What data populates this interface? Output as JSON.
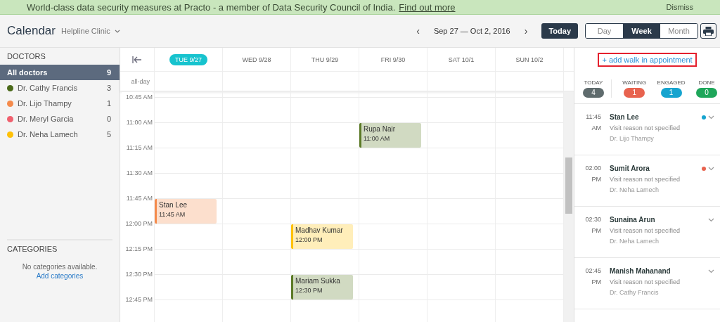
{
  "banner": {
    "message": "World-class data security measures at Practo - a member of Data Security Council of India.",
    "link": "Find out more",
    "dismiss": "Dismiss"
  },
  "header": {
    "title": "Calendar",
    "clinic": "Helpline Clinic",
    "range": "Sep 27 — Oct 2, 2016",
    "prev": "‹",
    "next": "›",
    "today": "Today",
    "views": [
      {
        "label": "Day",
        "selected": false
      },
      {
        "label": "Week",
        "selected": true
      },
      {
        "label": "Month",
        "selected": false
      }
    ]
  },
  "sidebar": {
    "doctors_heading": "DOCTORS",
    "doctors": [
      {
        "name": "All doctors",
        "count": "9",
        "selected": true
      },
      {
        "name": "Dr. Cathy Francis",
        "count": "3",
        "selected": false,
        "color": "#4b6a1a"
      },
      {
        "name": "Dr. Lijo Thampy",
        "count": "1",
        "selected": false,
        "color": "#f58b4c"
      },
      {
        "name": "Dr. Meryl Garcia",
        "count": "0",
        "selected": false,
        "color": "#f0606e"
      },
      {
        "name": "Dr. Neha Lamech",
        "count": "5",
        "selected": false,
        "color": "#ffc107"
      }
    ],
    "categories_heading": "CATEGORIES",
    "categories_empty": "No categories available.",
    "add_categories": "Add categories"
  },
  "calendar": {
    "days": [
      {
        "label": "TUE 9/27",
        "selected": true
      },
      {
        "label": "WED 9/28",
        "selected": false
      },
      {
        "label": "THU 9/29",
        "selected": false
      },
      {
        "label": "FRI 9/30",
        "selected": false
      },
      {
        "label": "SAT 10/1",
        "selected": false
      },
      {
        "label": "SUN 10/2",
        "selected": false
      }
    ],
    "all_day": "all-day",
    "rows": [
      {
        "time": "10:45 AM",
        "cells": [
          null,
          null,
          null,
          null,
          null,
          null
        ]
      },
      {
        "time": "11:00 AM",
        "cells": [
          null,
          null,
          null,
          {
            "name": "Rupa Nair",
            "time": "11:00 AM",
            "color": "#5b7a26"
          },
          null,
          null
        ]
      },
      {
        "time": "11:15 AM",
        "cells": [
          null,
          null,
          null,
          null,
          null,
          null
        ]
      },
      {
        "time": "11:30 AM",
        "cells": [
          null,
          null,
          null,
          null,
          null,
          null
        ]
      },
      {
        "time": "11:45 AM",
        "cells": [
          {
            "name": "Stan Lee",
            "time": "11:45 AM",
            "color": "#f58b4c"
          },
          null,
          null,
          null,
          null,
          null
        ]
      },
      {
        "time": "12:00 PM",
        "cells": [
          null,
          null,
          {
            "name": "Madhav Kumar",
            "time": "12:00 PM",
            "color": "#ffc107"
          },
          null,
          null,
          null
        ]
      },
      {
        "time": "12:15 PM",
        "cells": [
          null,
          null,
          null,
          null,
          null,
          null
        ]
      },
      {
        "time": "12:30 PM",
        "cells": [
          null,
          null,
          {
            "name": "Mariam Sukka",
            "time": "12:30 PM",
            "color": "#5b7a26"
          },
          null,
          null,
          null
        ]
      },
      {
        "time": "12:45 PM",
        "cells": [
          null,
          null,
          null,
          null,
          null,
          null
        ]
      }
    ]
  },
  "queue": {
    "add_walk_in": "+ add walk in appointment",
    "stats": [
      {
        "label": "TODAY",
        "count": "4",
        "color": "#5f6b6d"
      },
      {
        "label": "WAITING",
        "count": "1",
        "color": "#e8634f"
      },
      {
        "label": "ENGAGED",
        "count": "1",
        "color": "#16a4cf"
      },
      {
        "label": "DONE",
        "count": "0",
        "color": "#1ea65a"
      }
    ],
    "appointments": [
      {
        "hour": "11:45",
        "period": "AM",
        "patient": "Stan Lee",
        "reason": "Visit reason not specified",
        "doctor": "Dr. Lijo Thampy",
        "color": "#16a4cf"
      },
      {
        "hour": "02:00",
        "period": "PM",
        "patient": "Sumit Arora",
        "reason": "Visit reason not specified",
        "doctor": "Dr. Neha Lamech",
        "color": "#e8634f"
      },
      {
        "hour": "02:30",
        "period": "PM",
        "patient": "Sunaina Arun",
        "reason": "Visit reason not specified",
        "doctor": "Dr. Neha Lamech"
      },
      {
        "hour": "02:45",
        "period": "PM",
        "patient": "Manish Mahanand",
        "reason": "Visit reason not specified",
        "doctor": "Dr. Cathy Francis"
      }
    ]
  }
}
